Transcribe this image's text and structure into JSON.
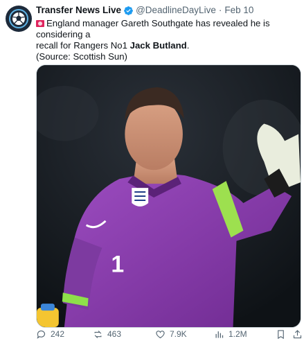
{
  "tweet": {
    "author_name": "Transfer News Live",
    "handle": "@DeadlineDayLive",
    "separator": "·",
    "date": "Feb 10",
    "text_line1": "England manager Gareth Southgate has revealed he is considering a",
    "text_line2_prefix": "recall for Rangers No1 ",
    "text_bold": "Jack Butland",
    "text_line2_suffix": ".",
    "source": "(Source: Scottish Sun)"
  },
  "actions": {
    "replies": "242",
    "reposts": "463",
    "likes": "7.9K",
    "views": "1.2M"
  },
  "colors": {
    "accent": "#1d9bf0",
    "muted": "#536471",
    "flag": "#e0245e",
    "kit": "#8e3fb0"
  },
  "icons": {
    "avatar": "football-icon",
    "verified": "verified-badge-icon",
    "flag": "alert-flag-icon",
    "reply": "reply-icon",
    "repost": "repost-icon",
    "like": "heart-icon",
    "views": "views-chart-icon",
    "bookmark": "bookmark-icon",
    "share": "share-icon"
  }
}
